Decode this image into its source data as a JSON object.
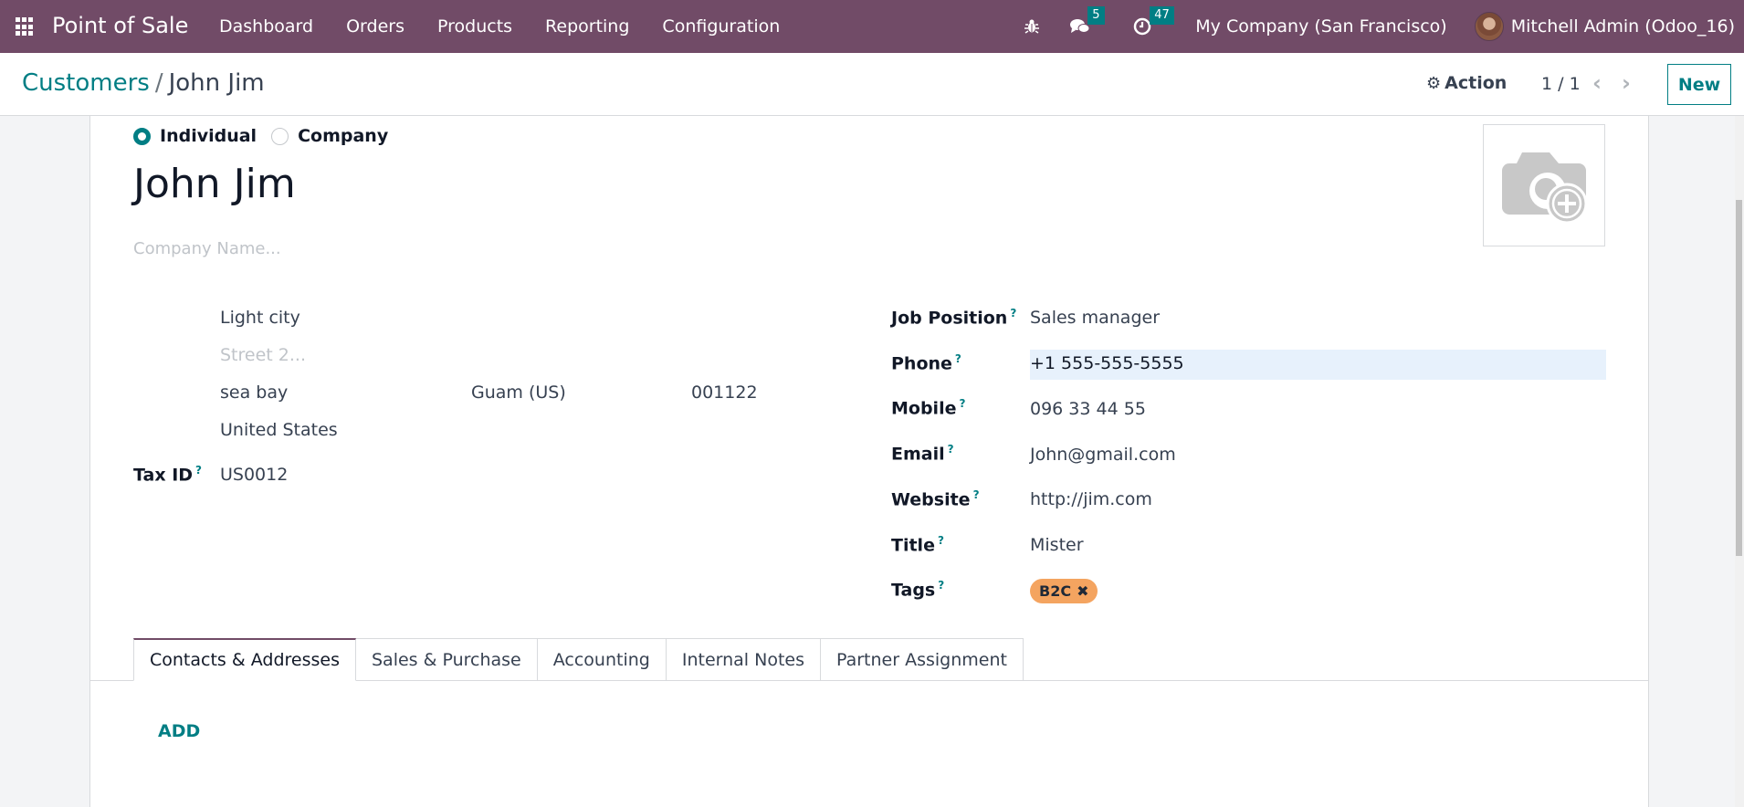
{
  "navbar": {
    "app_name": "Point of Sale",
    "menu": [
      "Dashboard",
      "Orders",
      "Products",
      "Reporting",
      "Configuration"
    ],
    "messages_count": "5",
    "activities_count": "47",
    "company": "My Company (San Francisco)",
    "user": "Mitchell Admin (Odoo_16)"
  },
  "control_panel": {
    "breadcrumb_parent": "Customers",
    "breadcrumb_separator": "/",
    "breadcrumb_current": "John Jim",
    "action_label": "Action",
    "pager": "1 / 1",
    "new_label": "New"
  },
  "form": {
    "company_type": {
      "options": [
        "Individual",
        "Company"
      ],
      "selected": "Individual"
    },
    "name": "John Jim",
    "company_name_placeholder": "Company Name...",
    "address": {
      "street": "Light city",
      "street2_placeholder": "Street 2...",
      "city": "sea bay",
      "state": "Guam (US)",
      "zip": "001122",
      "country": "United States"
    },
    "tax_id": {
      "label": "Tax ID",
      "value": "US0012"
    },
    "fields": [
      {
        "label": "Job Position",
        "value": "Sales manager"
      },
      {
        "label": "Phone",
        "value": "+1 555-555-5555"
      },
      {
        "label": "Mobile",
        "value": "096 33 44 55"
      },
      {
        "label": "Email",
        "value": "John@gmail.com"
      },
      {
        "label": "Website",
        "value": "http://jim.com"
      },
      {
        "label": "Title",
        "value": "Mister"
      },
      {
        "label": "Tags",
        "value": ""
      }
    ],
    "tags": [
      {
        "label": "B2C",
        "color": "#f4a460"
      }
    ],
    "help_marker": "?"
  },
  "tabs": [
    "Contacts & Addresses",
    "Sales & Purchase",
    "Accounting",
    "Internal Notes",
    "Partner Assignment"
  ],
  "active_tab": "Contacts & Addresses",
  "add_label": "ADD"
}
